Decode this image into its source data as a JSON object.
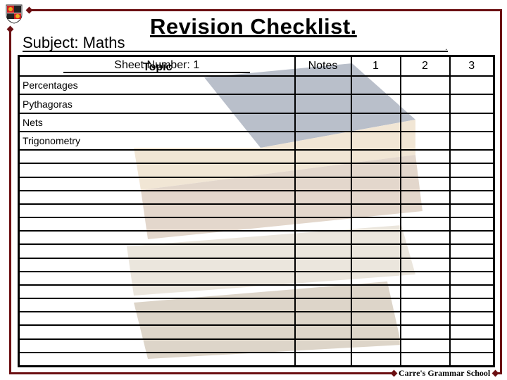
{
  "title": "Revision Checklist.",
  "subject": "Subject: Maths",
  "trailing_mark": ".",
  "sheet_number": "Sheet Number: 1",
  "columns": {
    "topic": "Topic",
    "notes": "Notes",
    "c1": "1",
    "c2": "2",
    "c3": "3"
  },
  "topics": [
    "Percentages",
    "Pythagoras",
    "Nets",
    "Trigonometry"
  ],
  "footer": "Carre's Grammar School",
  "colors": {
    "frame": "#6b0f12"
  }
}
